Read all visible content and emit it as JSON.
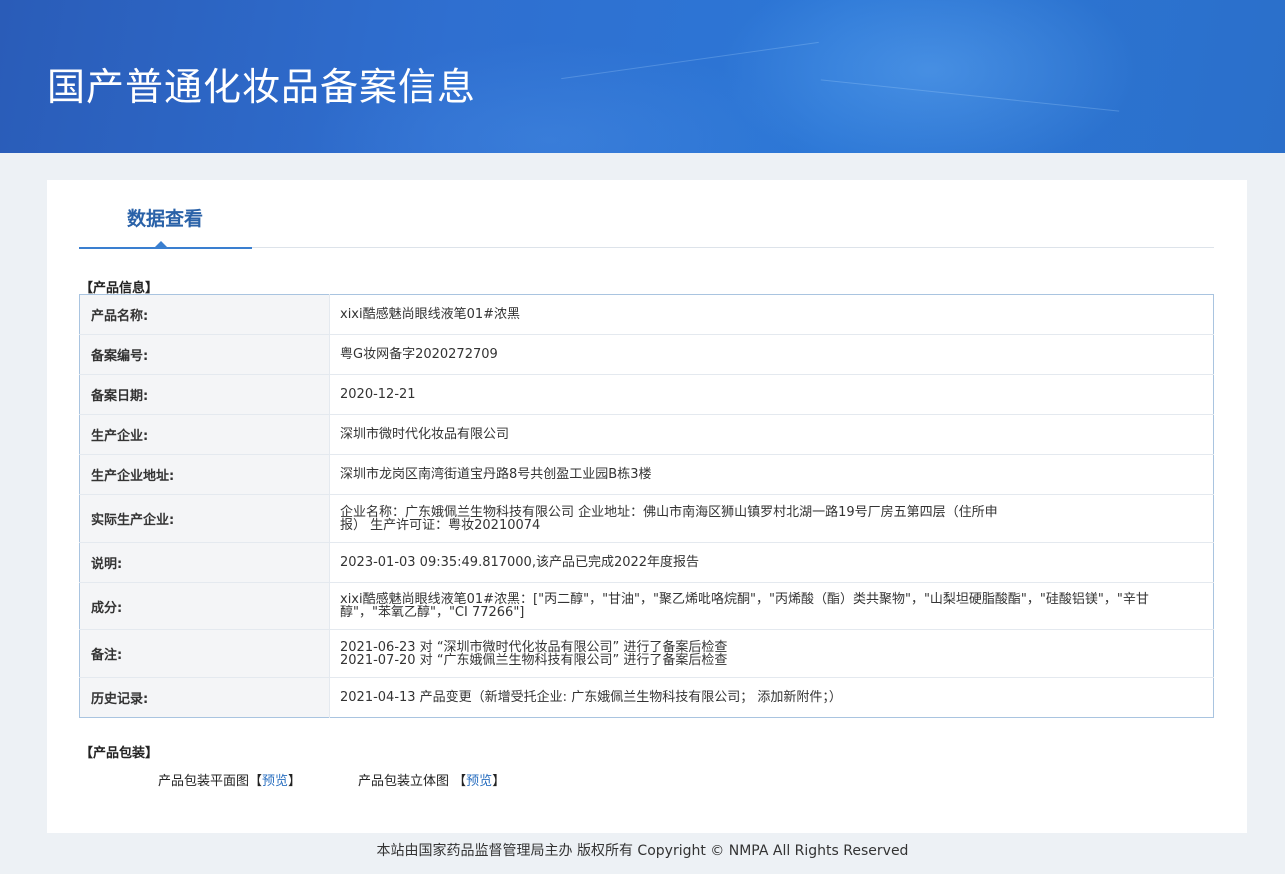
{
  "banner": {
    "title": "国产普通化妆品备案信息"
  },
  "tab": {
    "label": "数据查看"
  },
  "product_info": {
    "section_title": "【产品信息】",
    "rows": [
      {
        "key": "产品名称:",
        "value": "xixi酷感魅尚眼线液笔01#浓黑"
      },
      {
        "key": "备案编号:",
        "value": "粤G妆网备字2020272709"
      },
      {
        "key": "备案日期:",
        "value": "2020-12-21"
      },
      {
        "key": "生产企业:",
        "value": "深圳市微时代化妆品有限公司"
      },
      {
        "key": "生产企业地址:",
        "value": "深圳市龙岗区南湾街道宝丹路8号共创盈工业园B栋3楼"
      },
      {
        "key": "实际生产企业:",
        "value": "企业名称：广东娥佩兰生物科技有限公司 企业地址：佛山市南海区狮山镇罗村北湖一路19号厂房五第四层（住所申报） 生产许可证：粤妆20210074"
      },
      {
        "key": "说明:",
        "value": "2023-01-03 09:35:49.817000,该产品已完成2022年度报告"
      },
      {
        "key": "成分:",
        "value": "xixi酷感魅尚眼线液笔01#浓黑：[\"丙二醇\"，\"甘油\"，\"聚乙烯吡咯烷酮\"，\"丙烯酸（酯）类共聚物\"，\"山梨坦硬脂酸酯\"，\"硅酸铝镁\"，\"辛甘醇\"，\"苯氧乙醇\"，\"CI 77266\"]"
      },
      {
        "key": "备注:",
        "line1": "2021-06-23 对 “深圳市微时代化妆品有限公司” 进行了备案后检查",
        "line2": "2021-07-20 对 “广东娥佩兰生物科技有限公司” 进行了备案后检查"
      },
      {
        "key": "历史记录:",
        "value": "2021-04-13 产品变更（新增受托企业: 广东娥佩兰生物科技有限公司； 添加新附件；）"
      }
    ]
  },
  "packaging": {
    "section_title": "【产品包装】",
    "flat_label": "产品包装平面图",
    "stereo_label": "产品包装立体图",
    "bracket_open": "【",
    "bracket_close": "】",
    "preview_label": "预览"
  },
  "footer": {
    "text": "本站由国家药品监督管理局主办 版权所有 Copyright © NMPA All Rights Reserved"
  }
}
